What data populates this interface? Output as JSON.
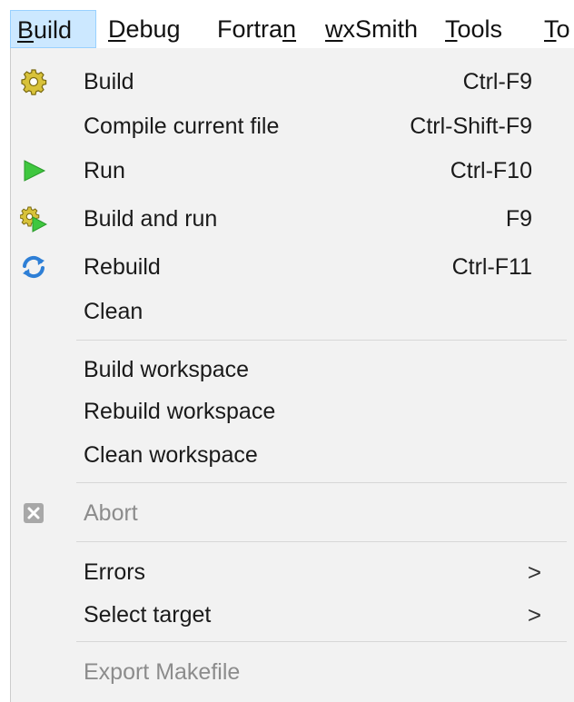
{
  "menubar": {
    "items": [
      {
        "pre": "",
        "ul": "B",
        "post": "uild"
      },
      {
        "pre": "",
        "ul": "D",
        "post": "ebug"
      },
      {
        "pre": "Fortra",
        "ul": "n",
        "post": ""
      },
      {
        "pre": "",
        "ul": "w",
        "post": "xSmith"
      },
      {
        "pre": "",
        "ul": "T",
        "post": "ools"
      },
      {
        "pre": "",
        "ul": "T",
        "post": "o"
      }
    ]
  },
  "build_menu": {
    "items": [
      {
        "label": "Build",
        "shortcut": "Ctrl-F9",
        "icon": "gear-icon"
      },
      {
        "label": "Compile current file",
        "shortcut": "Ctrl-Shift-F9"
      },
      {
        "label": "Run",
        "shortcut": "Ctrl-F10",
        "icon": "play-icon"
      },
      {
        "label": "Build and run",
        "shortcut": "F9",
        "icon": "build-and-run-icon"
      },
      {
        "label": "Rebuild",
        "shortcut": "Ctrl-F11",
        "icon": "rebuild-icon"
      },
      {
        "label": "Clean"
      },
      {
        "label": "Build workspace"
      },
      {
        "label": "Rebuild workspace"
      },
      {
        "label": "Clean workspace"
      },
      {
        "label": "Abort",
        "icon": "abort-icon",
        "disabled": true
      },
      {
        "label": "Errors",
        "submenu": true
      },
      {
        "label": "Select target",
        "submenu": true
      },
      {
        "label": "Export Makefile",
        "disabled": true
      }
    ],
    "submenu_arrow": ">"
  },
  "colors": {
    "menubar_active_bg": "#cce8ff",
    "menubar_active_border": "#99d1ff",
    "dropdown_bg": "#f2f2f2",
    "run_icon": "#3fc73f",
    "rebuild_icon": "#2e7fd6",
    "gear_icon": "#d8c23a",
    "disabled_text": "#8c8c8c"
  }
}
